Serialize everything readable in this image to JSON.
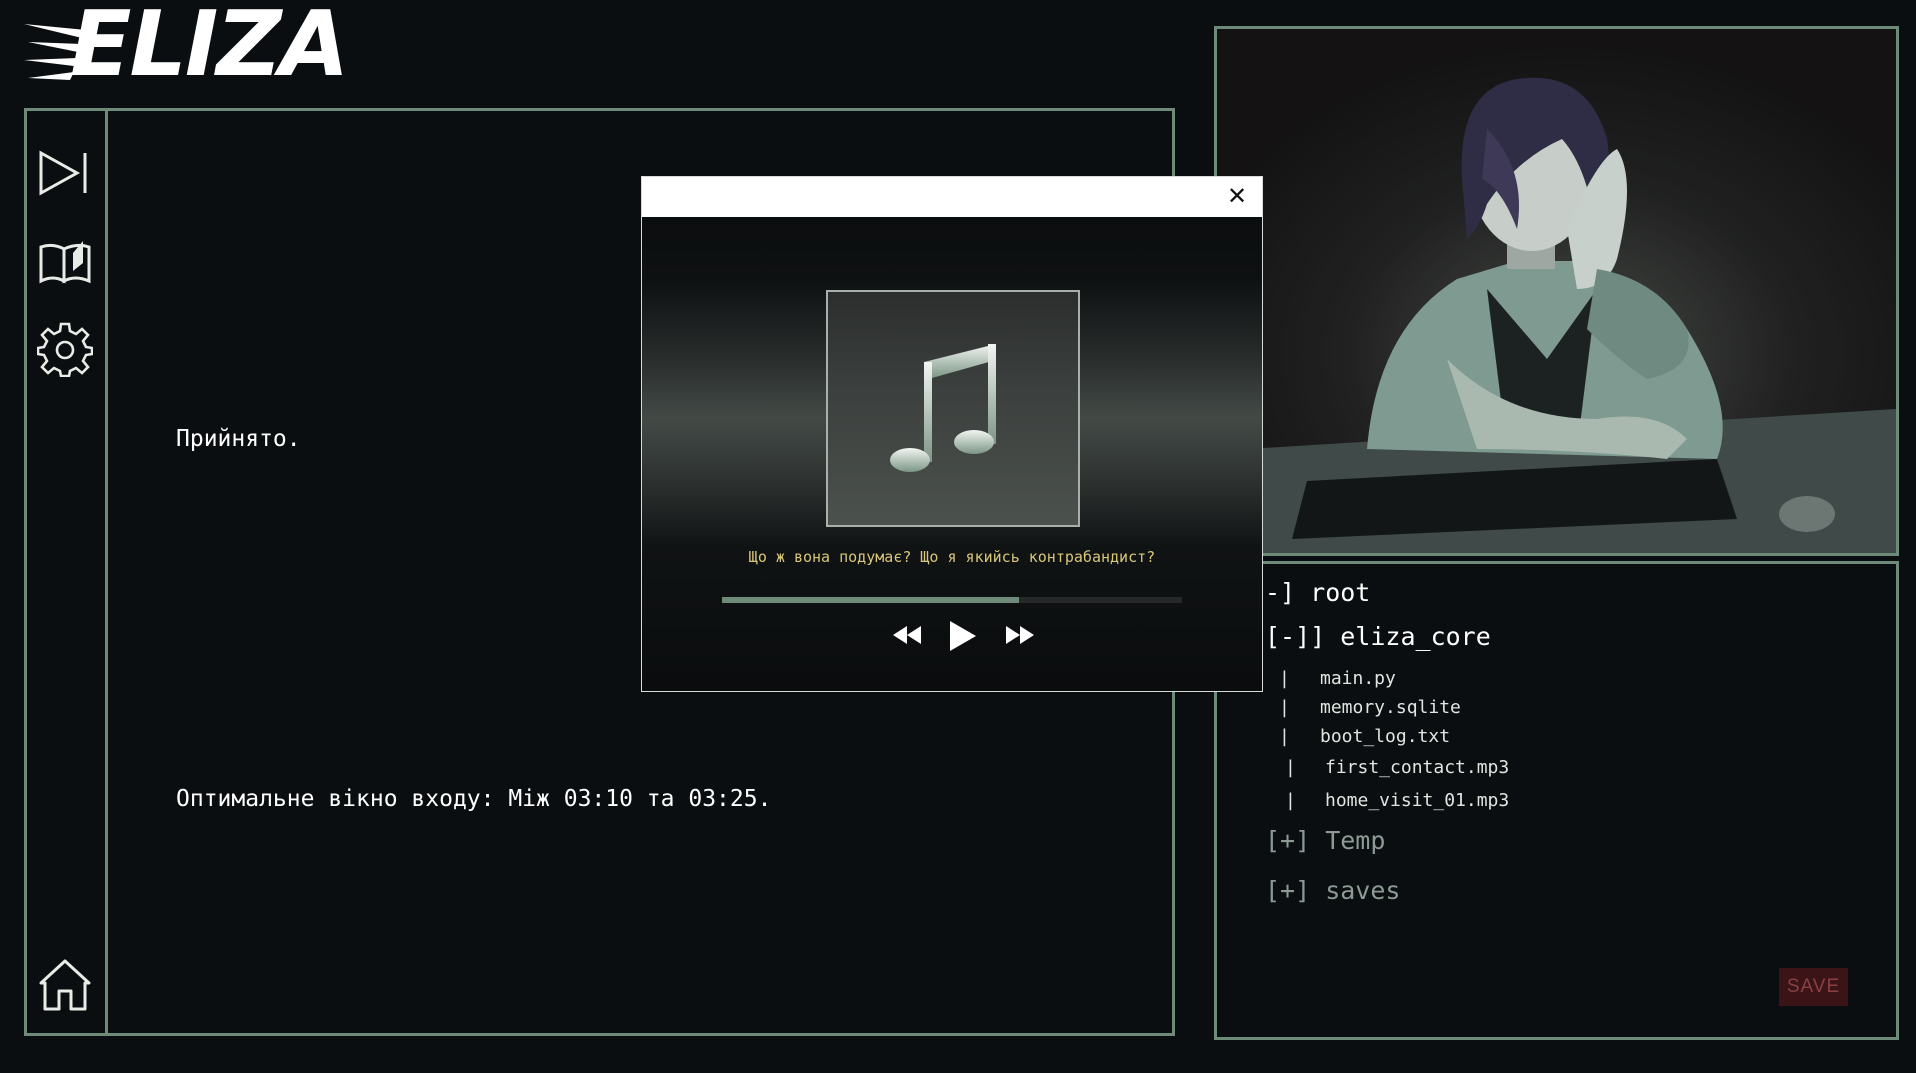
{
  "app": {
    "logo_text": "ELIZA"
  },
  "sidebar": {
    "items": [
      {
        "name": "skip-button",
        "icon": "skip-forward-icon"
      },
      {
        "name": "log-book-button",
        "icon": "open-book-icon"
      },
      {
        "name": "settings-button",
        "icon": "gear-icon"
      },
      {
        "name": "home-button",
        "icon": "home-icon"
      }
    ]
  },
  "dialog": {
    "line1": "Прийнято.",
    "line2": "Оптимальне вікно входу: Між 03:10 та 03:25."
  },
  "player": {
    "close_label": "✕",
    "album_icon": "music-note-icon",
    "track_title": "Що ж вона подумає? Що я якийсь контрабандист?",
    "progress": 0.645,
    "controls": {
      "rewind": "rewind-icon",
      "play": "play-icon",
      "forward": "fast-forward-icon"
    }
  },
  "filetree": {
    "root": "-] root",
    "core": "[-]] eliza_core",
    "files": [
      {
        "prefix": "|",
        "name": "main.py"
      },
      {
        "prefix": "|",
        "name": "memory.sqlite"
      },
      {
        "prefix": "|",
        "name": "boot_log.txt"
      },
      {
        "prefix": "|",
        "name": "first_contact.mp3"
      },
      {
        "prefix": "|",
        "name": "home_visit_01.mp3"
      }
    ],
    "temp": "[+] Temp",
    "saves": "[+] saves"
  },
  "save_button": {
    "label": "SAVE"
  },
  "colors": {
    "background": "#0a0e10",
    "frame": "#6e8a78",
    "track_title": "#d8c67a",
    "save_bg": "#3b1417",
    "save_text": "#8a4044"
  }
}
